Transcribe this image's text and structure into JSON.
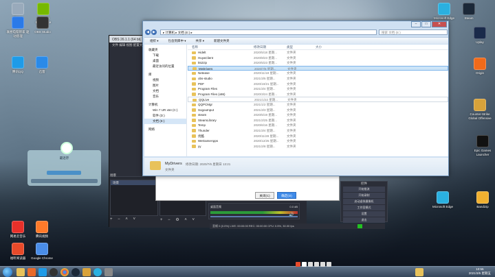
{
  "desktop_icons_left": [
    {
      "label": "回收站"
    },
    {
      "label": "GeForce Experience"
    },
    {
      "label": "联想电脑管家 驱动管理"
    },
    {
      "label": "OBS Studio"
    },
    {
      "label": "腾讯QQ"
    },
    {
      "label": "迅雷"
    },
    {
      "label": "网易云音乐"
    },
    {
      "label": "腾讯视频"
    },
    {
      "label": "福昕阅读器"
    },
    {
      "label": "Google Chrome"
    }
  ],
  "desktop_icons_right": [
    {
      "label": "Microsoft Edge"
    },
    {
      "label": "Steam"
    },
    {
      "label": "Uplay"
    },
    {
      "label": "Origin"
    },
    {
      "label": "Counter-Strike Global Offensive"
    },
    {
      "label": "Epic Games Launcher"
    },
    {
      "label": "Microsoft Edge"
    },
    {
      "label": "Bandizip"
    }
  ],
  "obs": {
    "title": "OBS 26.1.1 (64 bit, windows) - 配置文件: 未命名 - 场景: 未命名",
    "menu": "文件 编辑 视图 配置文件 场景集合 工具 帮助",
    "scenes_header": "场景",
    "sources_header": "来源",
    "scene_item": "场景",
    "mixer_label": "桌面音频",
    "mixer_db": "0.0 dB",
    "controls_header": "控件",
    "controls": [
      "开始推流",
      "开始录制",
      "启动虚拟摄像机",
      "工作室模式",
      "设置",
      "退出"
    ],
    "status": "丢帧 0 (0.0%)   LIVE: 00:00:00   REC: 00:00:00   CPU: 0.5%, 30.00 fps"
  },
  "dialog": {
    "cancel_label": "关闭(C)",
    "confirm_label": "确定(O)"
  },
  "explorer": {
    "breadcrumb": "▸ 计算机 ▸ 文档 (E:) ▸",
    "search_placeholder": "搜索 文档 (E:)",
    "toolbar": [
      "组织 ▾",
      "包含到库中 ▾",
      "共享 ▾",
      "新建文件夹"
    ],
    "nav": [
      {
        "label": "收藏夹",
        "group": true
      },
      {
        "label": "下载"
      },
      {
        "label": "桌面"
      },
      {
        "label": "最近访问的位置"
      },
      {
        "label": "库",
        "group": true
      },
      {
        "label": "视频"
      },
      {
        "label": "图片"
      },
      {
        "label": "文档"
      },
      {
        "label": "音乐"
      },
      {
        "label": "计算机",
        "group": true
      },
      {
        "label": "Win 7 UR x64 (C:)"
      },
      {
        "label": "软件 (D:)"
      },
      {
        "label": "文档 (E:)",
        "selected": true
      },
      {
        "label": "网络",
        "group": true
      }
    ],
    "columns": {
      "name": "名称",
      "date": "修改日期",
      "type": "类型",
      "size": "大小"
    },
    "files": [
      {
        "name": "Hidelt",
        "date": "2020/5/18 星期...",
        "type": "文件夹"
      },
      {
        "name": "HuyaClient",
        "date": "2020/8/23 星期...",
        "type": "文件夹"
      },
      {
        "name": "k52zip",
        "date": "2020/5/23 星期...",
        "type": "文件夹"
      },
      {
        "name": "MyDrivers",
        "date": "2020/7/6 星期...",
        "type": "文件夹",
        "selected": true
      },
      {
        "name": "Netease",
        "date": "2020/11/18 星期...",
        "type": "文件夹"
      },
      {
        "name": "obs-studio",
        "date": "2021/3/5 星期...",
        "type": "文件夹"
      },
      {
        "name": "PDF",
        "date": "2020/10/21 星期...",
        "type": "文件夹"
      },
      {
        "name": "Program Files",
        "date": "2021/3/4 星期...",
        "type": "文件夹"
      },
      {
        "name": "Program Files (x86)",
        "date": "2020/3/24 星期...",
        "type": "文件夹"
      },
      {
        "name": "QQLive",
        "date": "2021/1/22 星期...",
        "type": "文件夹",
        "hover": true
      },
      {
        "name": "QQPCMgr",
        "date": "2021/1/2 星期...",
        "type": "文件夹"
      },
      {
        "name": "SogouInput",
        "date": "2021/3/3 星期...",
        "type": "文件夹"
      },
      {
        "name": "steam",
        "date": "2020/5/19 星期...",
        "type": "文件夹"
      },
      {
        "name": "SteamLibrary",
        "date": "2021/2/25 星期...",
        "type": "文件夹"
      },
      {
        "name": "Temp",
        "date": "2020/6/16 星期...",
        "type": "文件夹"
      },
      {
        "name": "Thunder",
        "date": "2021/3/4 星期...",
        "type": "文件夹"
      },
      {
        "name": "优酷",
        "date": "2020/11/28 星期...",
        "type": "文件夹"
      },
      {
        "name": "WeGameApps",
        "date": "2020/12/25 星期...",
        "type": "文件夹"
      },
      {
        "name": "yy",
        "date": "2021/2/8 星期...",
        "type": "文件夹"
      }
    ],
    "details": {
      "name": "MyDrivers",
      "meta": "修改日期: 2020/7/6 星期日 13:21",
      "type": "文件夹"
    }
  },
  "widget": {
    "name": "最近存"
  },
  "clock": {
    "time": "10:55",
    "date": "2021/3/5 星期五"
  },
  "colors": {
    "accent": "#3e6fb5",
    "selection": "#cce4f7",
    "folder": "#e8c25a",
    "obs_bg": "#2b2e38"
  }
}
